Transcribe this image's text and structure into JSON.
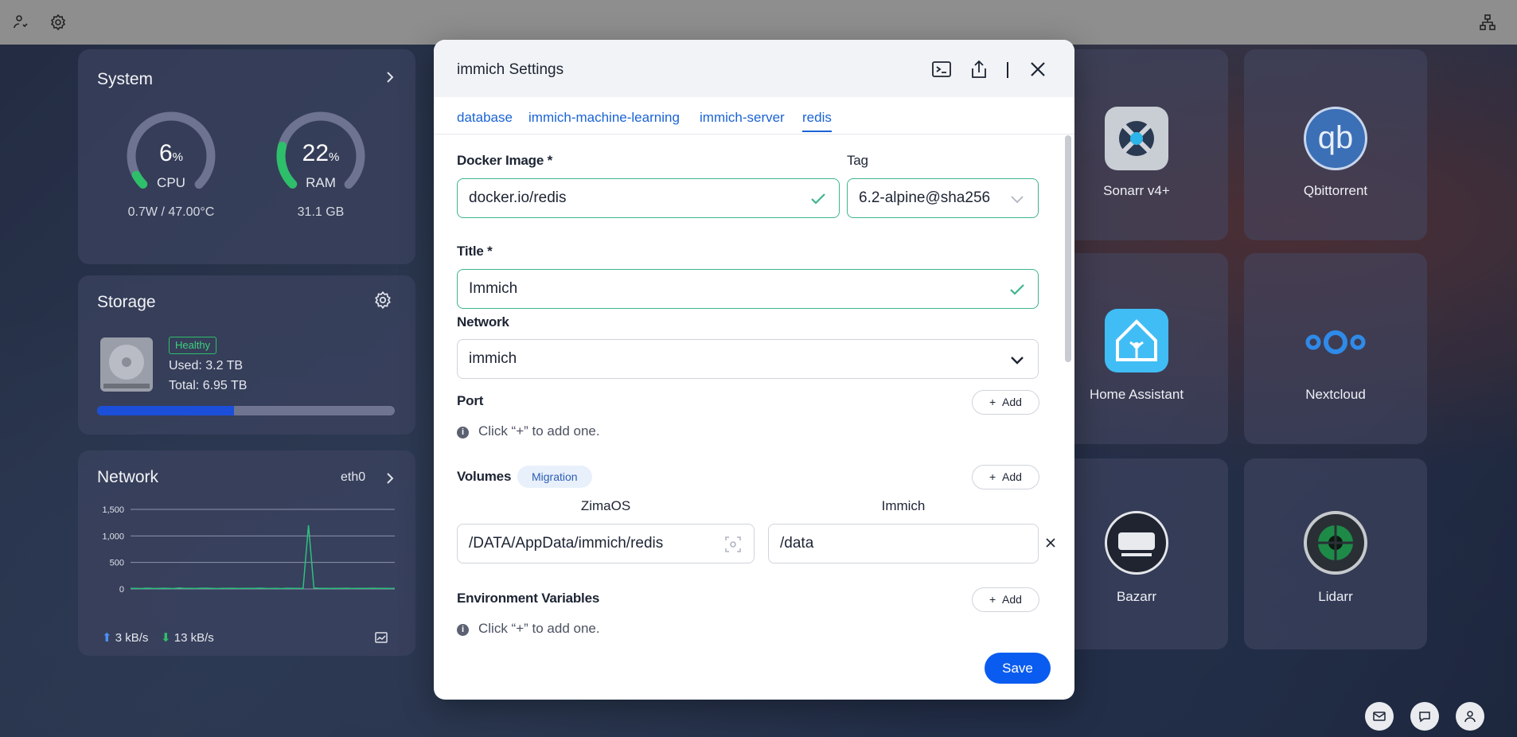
{
  "system": {
    "title": "System",
    "cpu": {
      "value": "6",
      "unit": "%",
      "label": "CPU",
      "sub": "0.7W / 47.00°C",
      "fraction": 0.06
    },
    "ram": {
      "value": "22",
      "unit": "%",
      "label": "RAM",
      "sub": "31.1 GB",
      "fraction": 0.22
    }
  },
  "storage": {
    "title": "Storage",
    "status": "Healthy",
    "used": "Used: 3.2 TB",
    "total": "Total: 6.95 TB",
    "used_fraction": 0.46
  },
  "network": {
    "title": "Network",
    "iface": "eth0",
    "up": "3 kB/s",
    "down": "13 kB/s"
  },
  "chart_data": {
    "type": "line",
    "yticks": [
      "1,500",
      "1,000",
      "500",
      "0"
    ],
    "ylim": [
      0,
      1500
    ],
    "series": [
      {
        "values": [
          10,
          12,
          8,
          15,
          10,
          9,
          14,
          11,
          8,
          20,
          12,
          10,
          9,
          13,
          15,
          10,
          8,
          11,
          12,
          14,
          9,
          10,
          12,
          11,
          15,
          10,
          9,
          12,
          8,
          14,
          11,
          10,
          9,
          1200,
          20,
          10,
          12,
          9,
          11,
          10,
          13,
          9,
          12,
          10,
          11,
          14,
          10,
          12,
          9,
          11
        ]
      }
    ]
  },
  "apps": [
    {
      "label": "Sonarr v4+"
    },
    {
      "label": "Qbittorrent"
    },
    {
      "label": "Home Assistant"
    },
    {
      "label": "Nextcloud"
    },
    {
      "label": "Bazarr"
    },
    {
      "label": "Lidarr"
    }
  ],
  "modal": {
    "title": "immich Settings",
    "tabs": [
      "database",
      "immich-machine-learning",
      "immich-server",
      "redis"
    ],
    "active_tab": "redis",
    "docker_image_label": "Docker Image *",
    "docker_image_value": "docker.io/redis",
    "tag_label": "Tag",
    "tag_value": "6.2-alpine@sha256",
    "title_label": "Title *",
    "title_value": "Immich",
    "network_label": "Network",
    "network_value": "immich",
    "port_label": "Port",
    "add_label": "Add",
    "hint": "Click “+” to add one.",
    "volumes_label": "Volumes",
    "migration_label": "Migration",
    "host_col": "ZimaOS",
    "container_col": "Immich",
    "host_path": "/DATA/AppData/immich/redis",
    "container_path": "/data",
    "env_label": "Environment Variables",
    "save_label": "Save"
  },
  "colors": {
    "accent": "#0a5cf0",
    "link": "#1a63d6",
    "ok": "#3fb58b",
    "gauge": "#2ebf6a"
  }
}
